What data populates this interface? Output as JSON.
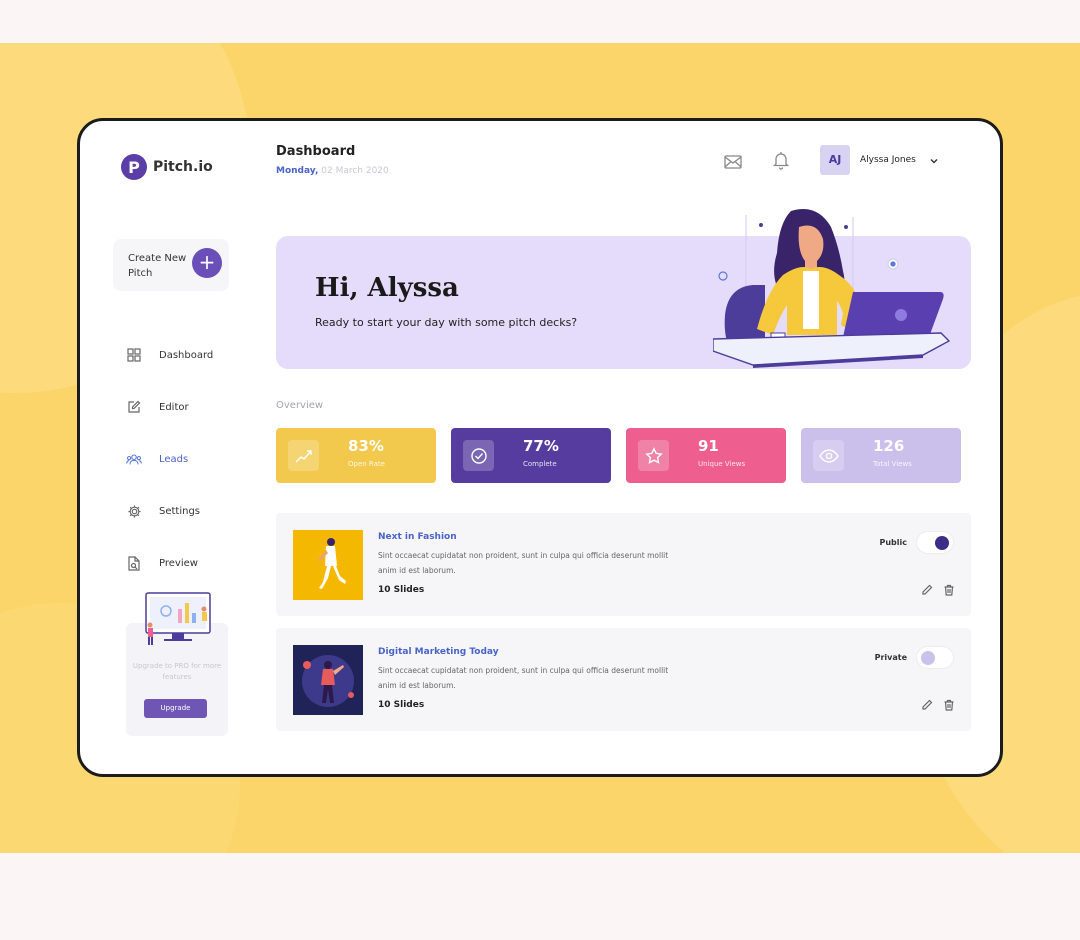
{
  "app": {
    "logo_letter": "P",
    "name": "Pitch.io"
  },
  "sidebar": {
    "create": {
      "label": "Create New Pitch",
      "plus": "+"
    },
    "items": [
      {
        "label": "Dashboard",
        "icon": "grid-icon"
      },
      {
        "label": "Editor",
        "icon": "edit-square-icon"
      },
      {
        "label": "Leads",
        "icon": "users-icon"
      },
      {
        "label": "Settings",
        "icon": "gear-icon"
      },
      {
        "label": "Preview",
        "icon": "file-preview-icon"
      }
    ],
    "active_item": "Leads",
    "promo": {
      "text": "Upgrade to PRO for more features",
      "button": "Upgrade"
    }
  },
  "header": {
    "title": "Dashboard",
    "day": "Monday,",
    "date": "02 March 2020",
    "user_initials": "AJ",
    "user_name": "Alyssa Jones"
  },
  "hero": {
    "title": "Hi, Alyssa",
    "subtitle": "Ready to start your day with some pitch decks?"
  },
  "overview": {
    "title": "Overview",
    "stats": [
      {
        "value": "83%",
        "label": "Open Rate",
        "icon": "trend-icon",
        "color": "#f2c94c"
      },
      {
        "value": "77%",
        "label": "Complete",
        "icon": "check-circle-icon",
        "color": "#553c9e"
      },
      {
        "value": "91",
        "label": "Unique Views",
        "icon": "star-icon",
        "color": "#ee5f8f"
      },
      {
        "value": "126",
        "label": "Total Views",
        "icon": "eye-icon",
        "color": "#cbbfec"
      }
    ]
  },
  "pitches": [
    {
      "title": "Next in Fashion",
      "description": "Sint occaecat cupidatat non proident, sunt in culpa qui officia deserunt mollit anim id est laborum.",
      "slides": "10 Slides",
      "visibility": "Public",
      "toggle_on": true
    },
    {
      "title": "Digital Marketing Today",
      "description": "Sint occaecat cupidatat non proident, sunt in culpa qui officia deserunt mollit anim id est laborum.",
      "slides": "10 Slides",
      "visibility": "Private",
      "toggle_on": false
    }
  ],
  "colors": {
    "accent": "#6b4fb8",
    "link": "#4a63c9",
    "background": "#fcd56a"
  }
}
